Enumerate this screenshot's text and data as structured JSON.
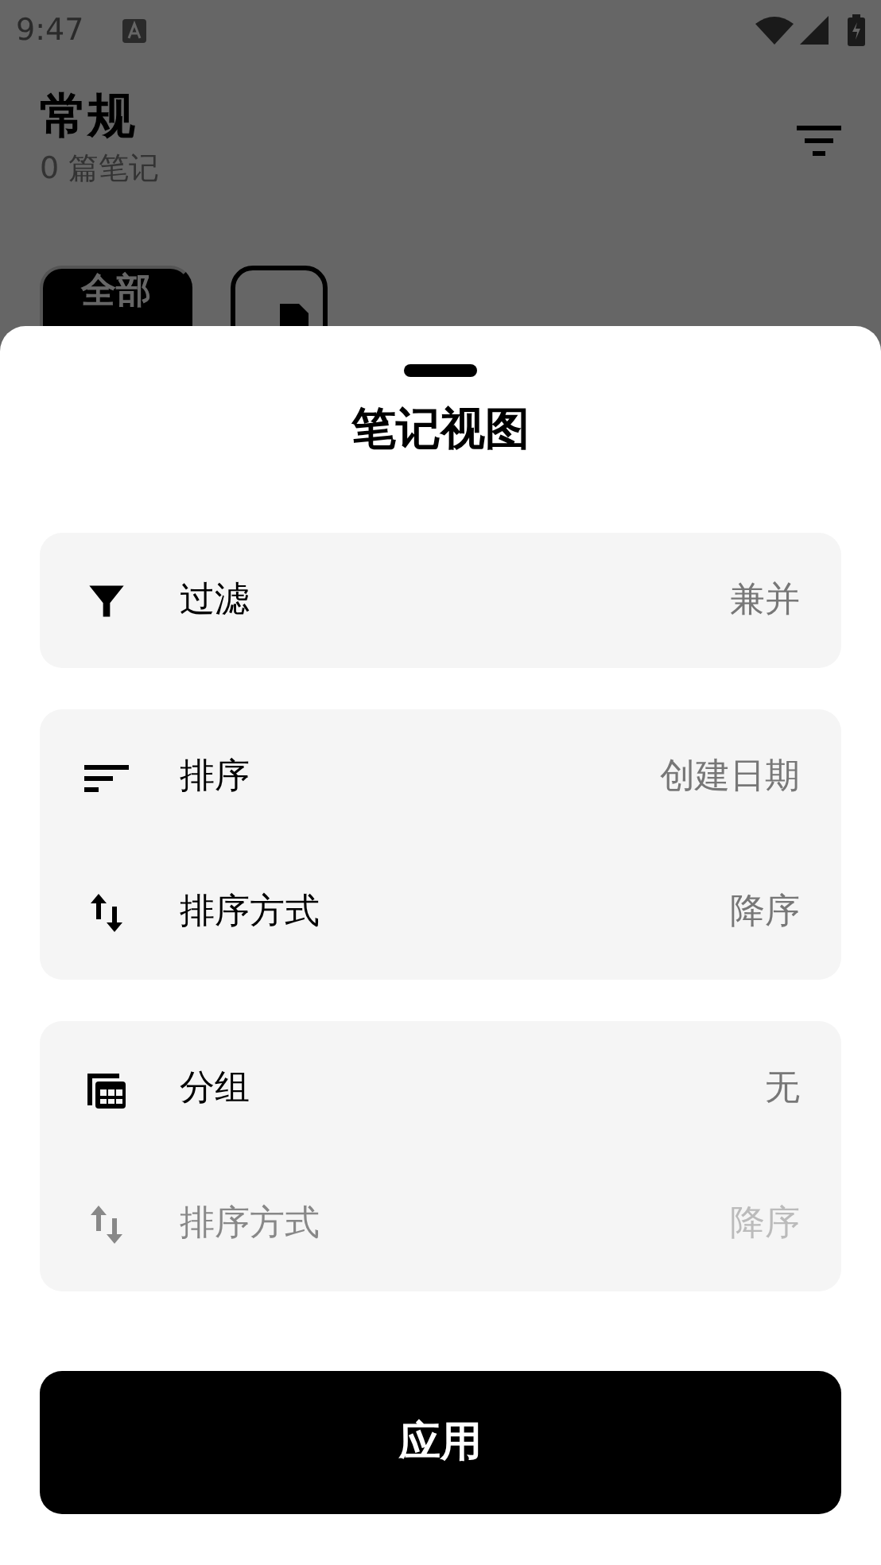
{
  "status_bar": {
    "time": "9:47"
  },
  "header": {
    "title": "常规",
    "subtitle": "0 篇笔记"
  },
  "chips": [
    {
      "kind": "text",
      "label": "全部",
      "selected": true
    },
    {
      "kind": "tag",
      "selected": false
    }
  ],
  "sheet": {
    "title": "笔记视图",
    "groups": [
      {
        "items": [
          {
            "kind": "filter",
            "label": "过滤",
            "value": "兼并",
            "disabled": false
          }
        ]
      },
      {
        "items": [
          {
            "kind": "sort",
            "label": "排序",
            "value": "创建日期",
            "disabled": false
          },
          {
            "kind": "order",
            "label": "排序方式",
            "value": "降序",
            "disabled": false
          }
        ]
      },
      {
        "items": [
          {
            "kind": "group",
            "label": "分组",
            "value": "无",
            "disabled": false
          },
          {
            "kind": "order",
            "label": "排序方式",
            "value": "降序",
            "disabled": true
          }
        ]
      }
    ],
    "apply_button": "应用"
  }
}
